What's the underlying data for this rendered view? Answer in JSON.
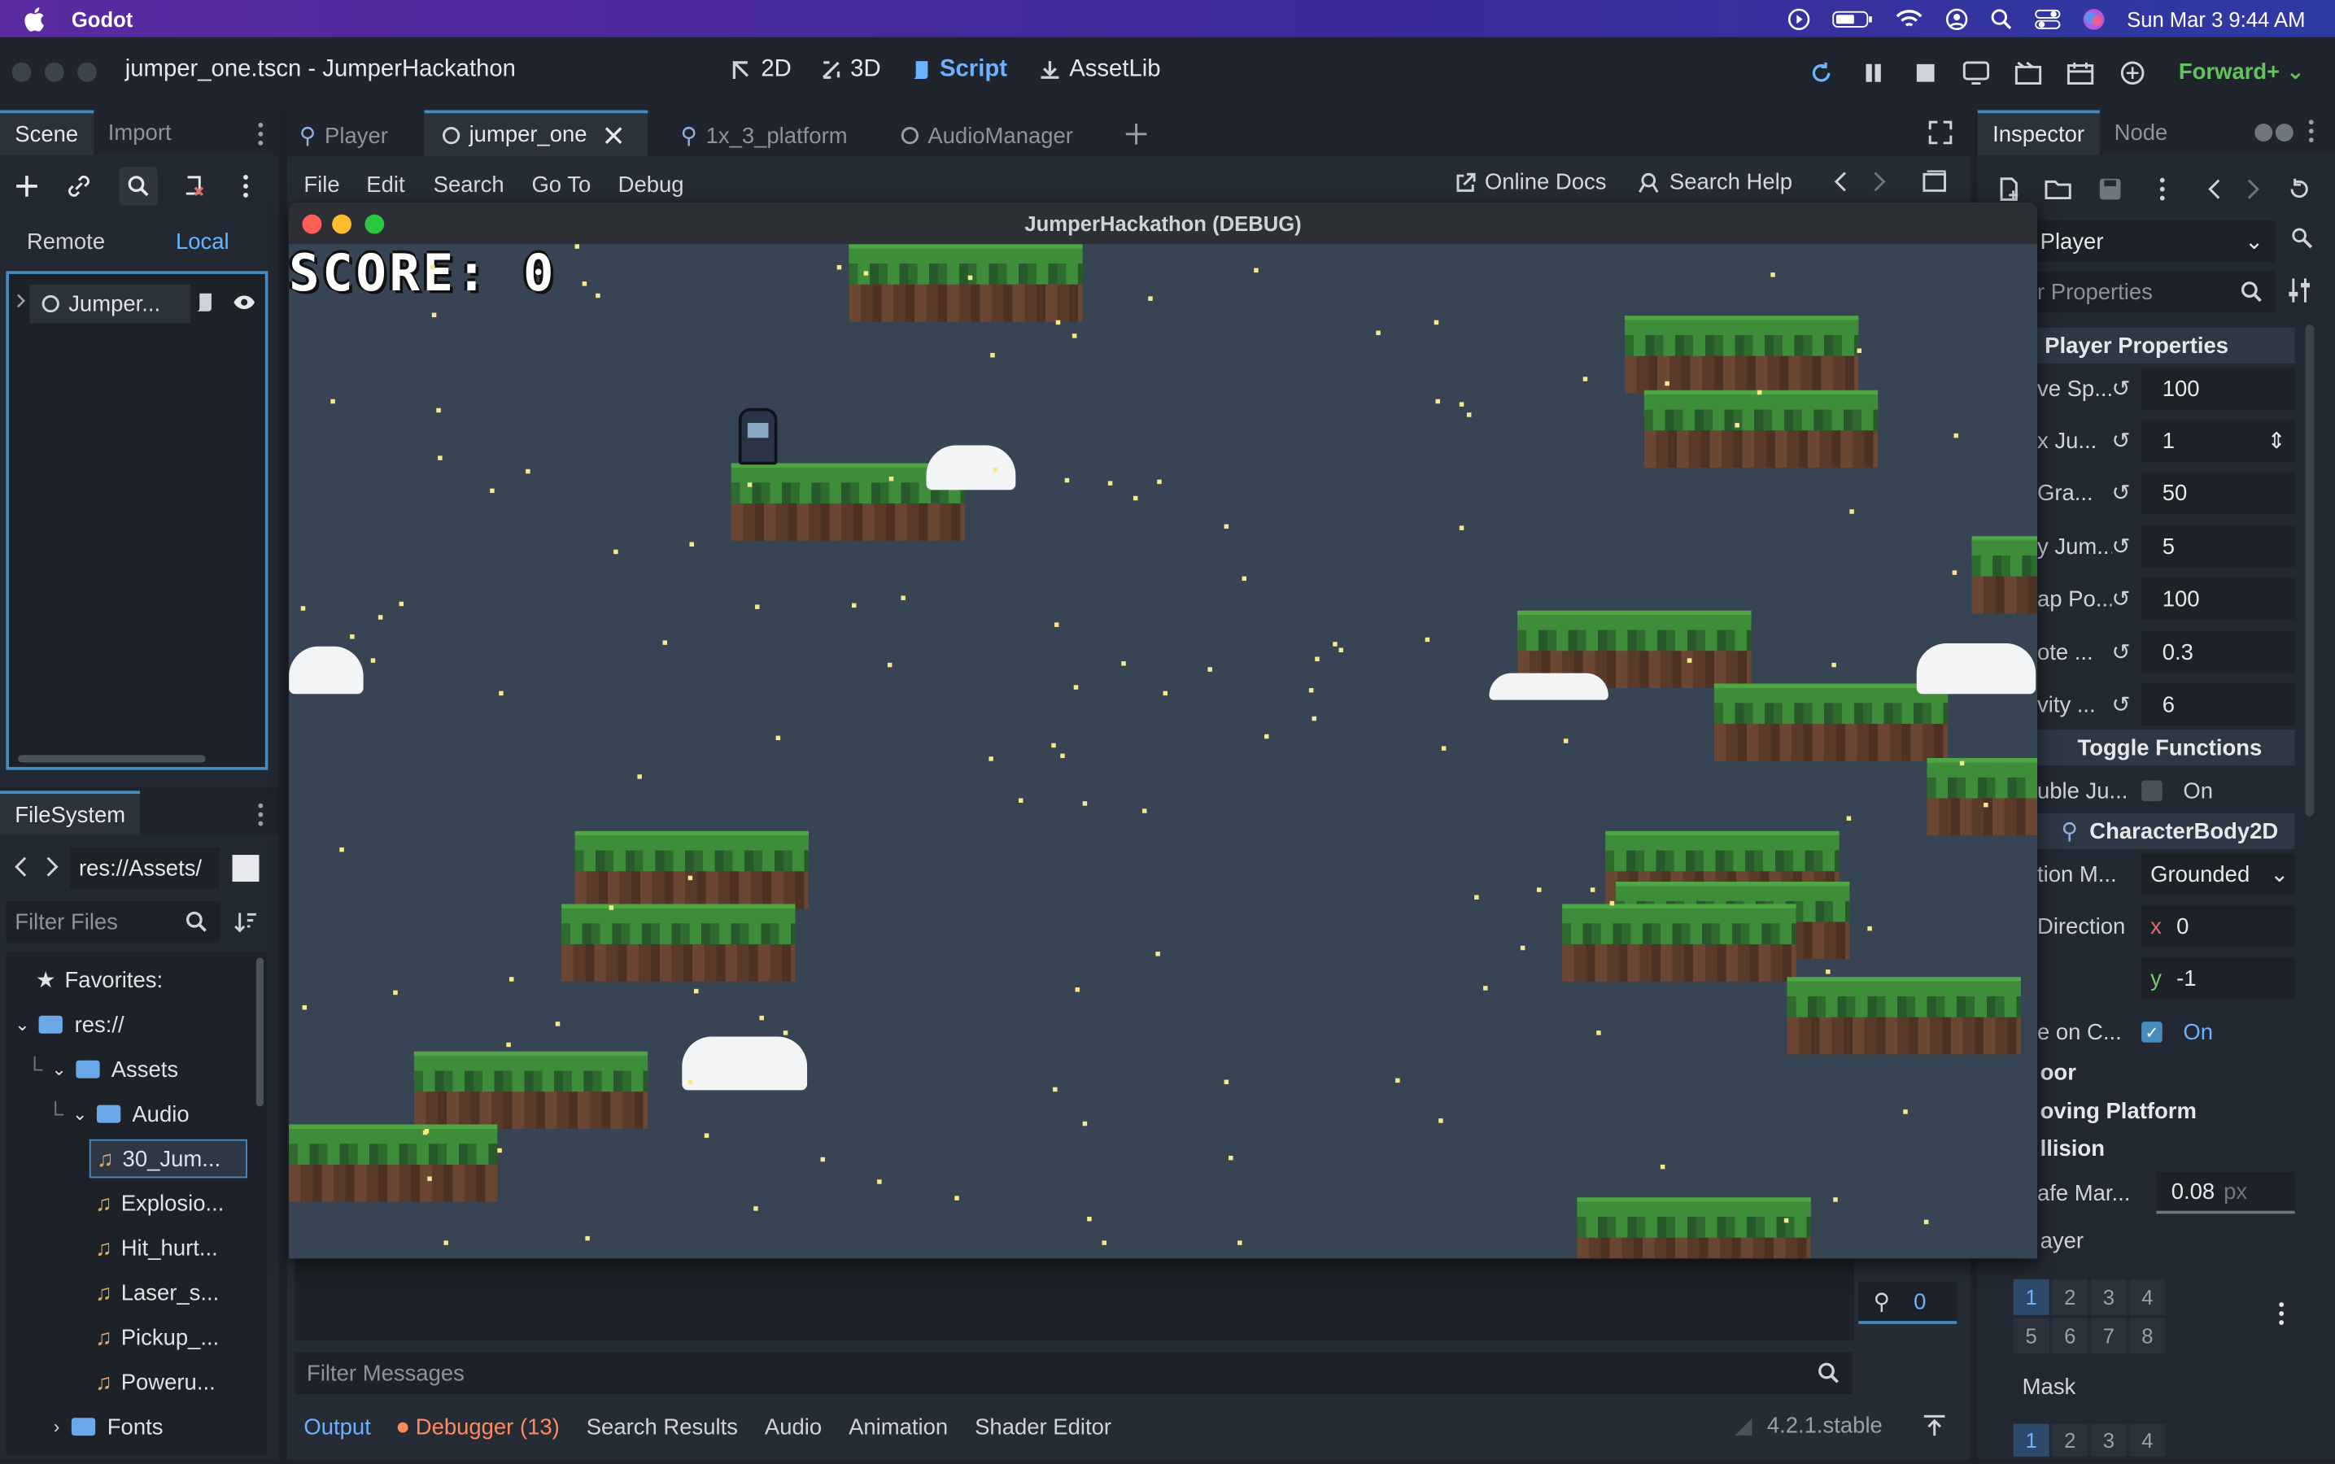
{
  "macos": {
    "app": "Godot",
    "datetime": "Sun Mar 3  9:44 AM"
  },
  "window": {
    "title": "jumper_one.tscn - JumperHackathon"
  },
  "main_buttons": [
    {
      "label": "2D"
    },
    {
      "label": "3D"
    },
    {
      "label": "Script",
      "active": true
    },
    {
      "label": "AssetLib"
    }
  ],
  "renderer": "Forward+",
  "scene_panel": {
    "tabs": [
      "Scene",
      "Import"
    ],
    "remote": "Remote",
    "local": "Local",
    "root_node": "Jumper..."
  },
  "filesystem": {
    "title": "FileSystem",
    "path": "res://Assets/",
    "filter_placeholder": "Filter Files",
    "items": [
      "Favorites:",
      "res://",
      "Assets",
      "Audio",
      "30_Jum...",
      "Explosio...",
      "Hit_hurt...",
      "Laser_s...",
      "Pickup_...",
      "Poweru...",
      "Fonts"
    ]
  },
  "script_tabs": [
    "Player",
    "jumper_one",
    "1x_3_platform",
    "AudioManager"
  ],
  "script_menu": {
    "items": [
      "File",
      "Edit",
      "Search",
      "Go To",
      "Debug"
    ],
    "online_docs": "Online Docs",
    "search_help": "Search Help"
  },
  "game": {
    "title": "JumperHackathon (DEBUG)",
    "score": "SCORE: 0"
  },
  "bottom": {
    "filter_placeholder": "Filter Messages",
    "tabs": [
      "Output",
      "Debugger (13)",
      "Search Results",
      "Audio",
      "Animation",
      "Shader Editor"
    ],
    "version": "4.2.1.stable",
    "counter": "0"
  },
  "inspector": {
    "tabs": [
      "Inspector",
      "Node"
    ],
    "object": "Player",
    "filter": "r Properties",
    "section_player": "Player Properties",
    "props": [
      {
        "name": "ve Sp...",
        "value": "100"
      },
      {
        "name": "x Ju...",
        "value": "1"
      },
      {
        "name": " Gra...",
        "value": "50"
      },
      {
        "name": "y Jum...",
        "value": "5"
      },
      {
        "name": "ap Po...",
        "value": "100"
      },
      {
        "name": "ote ...",
        "value": "0.3"
      },
      {
        "name": "vity ...",
        "value": "6"
      }
    ],
    "section_toggle": "Toggle Functions",
    "double_jump": {
      "name": "uble Ju...",
      "value": "On"
    },
    "section_body": "CharacterBody2D",
    "motion_mode": {
      "name": "tion M...",
      "value": "Grounded"
    },
    "up_direction": {
      "name": "Direction",
      "x": "0",
      "y": "-1"
    },
    "slide_on_ceiling": {
      "name": "e on C...",
      "value": "On"
    },
    "groups": [
      "oor",
      "oving Platform",
      "llision"
    ],
    "safe_margin": {
      "name": "afe Mar...",
      "value": "0.08",
      "unit": "px"
    },
    "layer_label": "ayer",
    "layer_cells": [
      "1",
      "2",
      "3",
      "4",
      "5",
      "6",
      "7",
      "8"
    ],
    "mask_label": "Mask",
    "mask_cells": [
      "1",
      "2",
      "3",
      "4"
    ]
  }
}
